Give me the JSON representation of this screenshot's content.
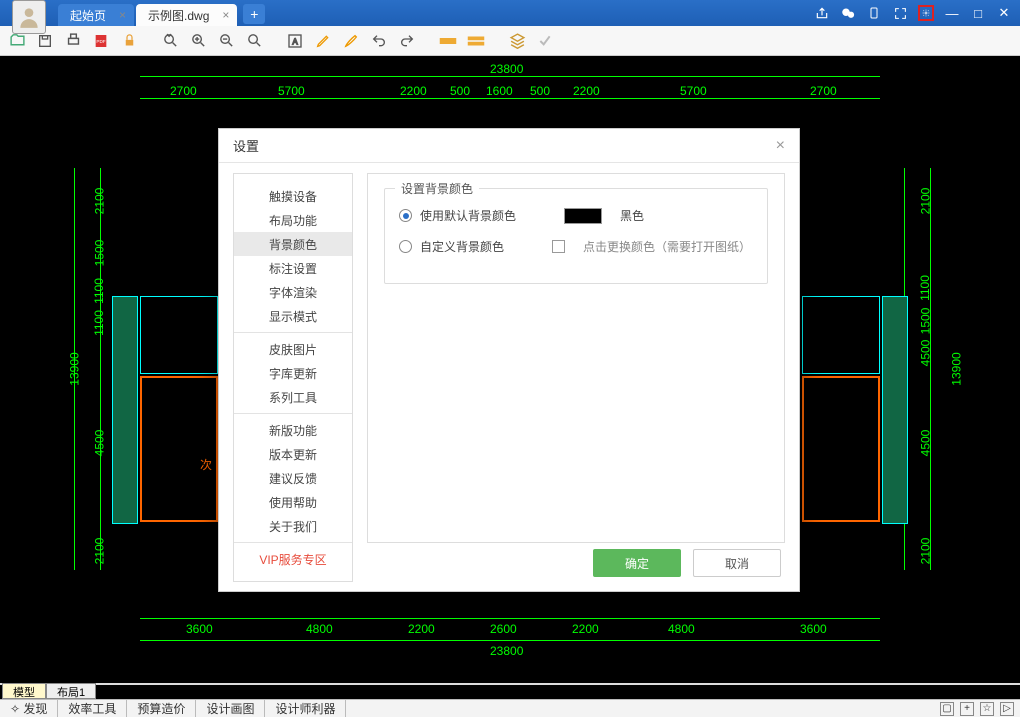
{
  "titlebar": {
    "tab_start": "起始页",
    "tab_active": "示例图.dwg"
  },
  "dimensions": {
    "overall": "23800",
    "top": [
      "2700",
      "5700",
      "2200",
      "500",
      "1600",
      "500",
      "2200",
      "5700",
      "2700"
    ],
    "bottom": [
      "3600",
      "4800",
      "2200",
      "2600",
      "2200",
      "4800",
      "3600"
    ],
    "left": [
      "2100",
      "1500",
      "1100",
      "1100",
      "4500",
      "2100"
    ],
    "left_total": "13900",
    "right": [
      "2100",
      "1100",
      "1500",
      "4500",
      "2100"
    ],
    "right_total": "13900"
  },
  "room_label": "次",
  "layout_tabs": {
    "model": "模型",
    "layout1": "布局1"
  },
  "bottombar": {
    "discover": "发现",
    "items": [
      "效率工具",
      "预算造价",
      "设计画图",
      "设计师利器"
    ]
  },
  "dialog": {
    "title": "设置",
    "sidebar_groups": [
      [
        "触摸设备",
        "布局功能",
        "背景颜色",
        "标注设置",
        "字体渲染",
        "显示模式"
      ],
      [
        "皮肤图片",
        "字库更新",
        "系列工具"
      ],
      [
        "新版功能",
        "版本更新",
        "建议反馈",
        "使用帮助",
        "关于我们"
      ],
      [
        "VIP服务专区"
      ]
    ],
    "selected_item": "背景颜色",
    "panel": {
      "legend": "设置背景颜色",
      "opt_default": "使用默认背景颜色",
      "color_label": "黑色",
      "opt_custom": "自定义背景颜色",
      "custom_hint": "点击更换颜色（需要打开图纸）"
    },
    "ok": "确定",
    "cancel": "取消"
  }
}
